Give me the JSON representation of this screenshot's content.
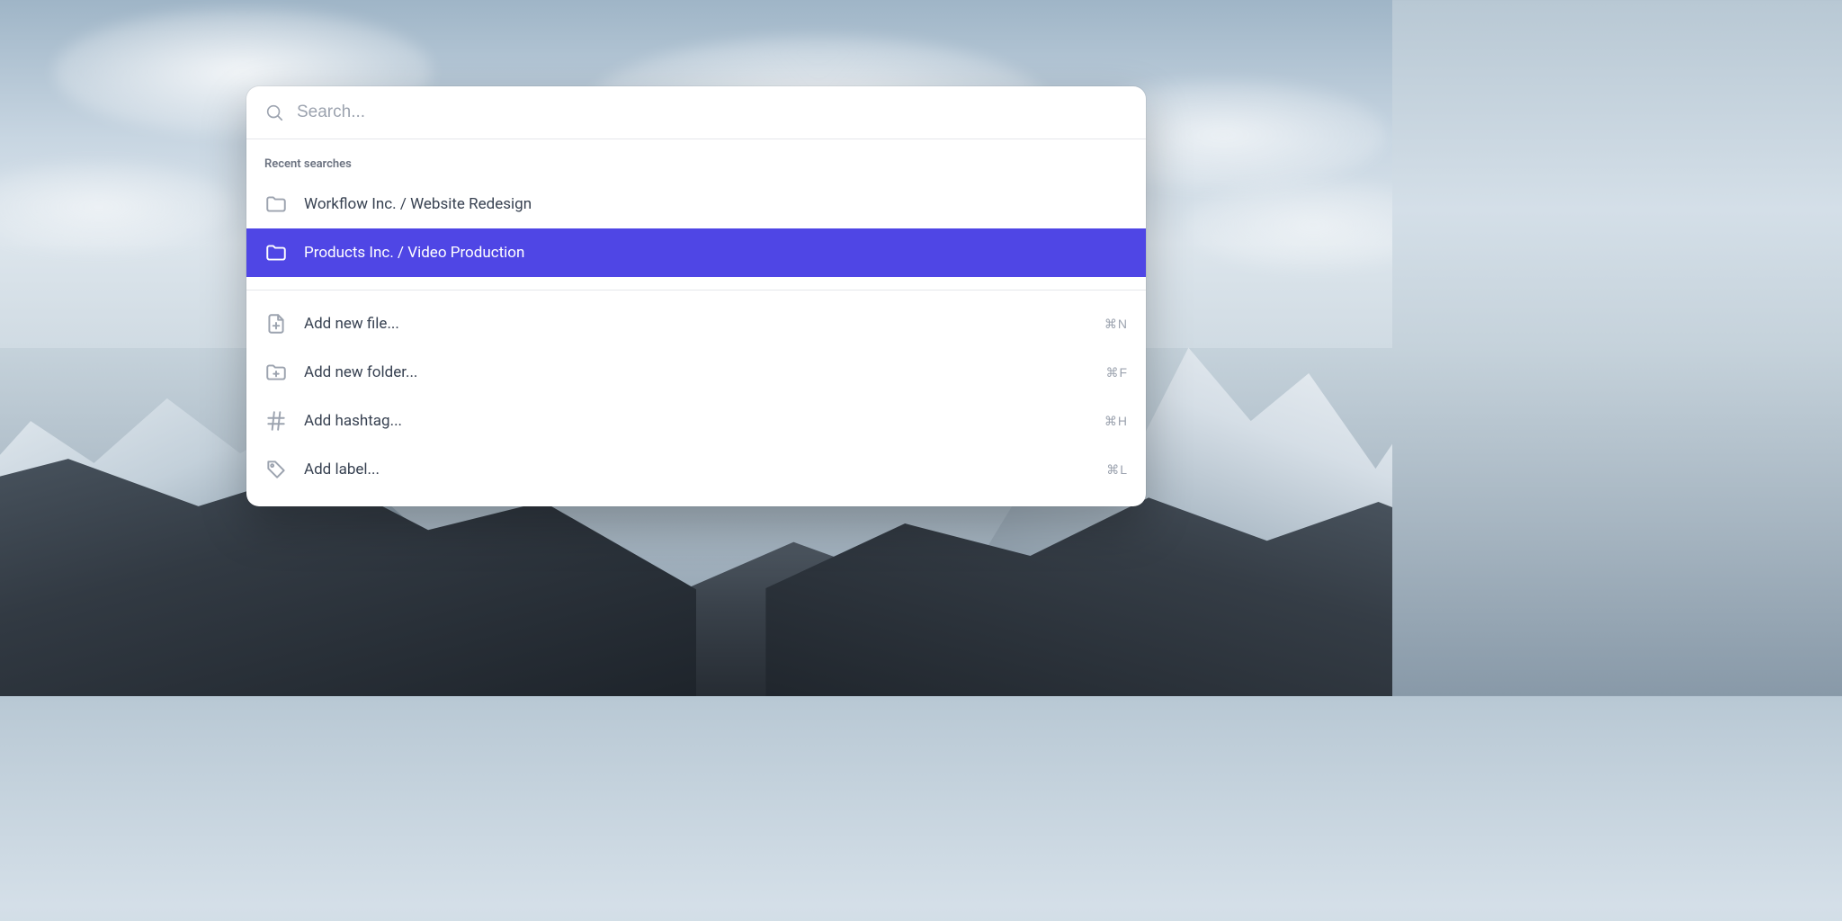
{
  "search": {
    "placeholder": "Search...",
    "value": ""
  },
  "recent": {
    "heading": "Recent searches",
    "items": [
      {
        "label": "Workflow Inc. / Website Redesign",
        "selected": false
      },
      {
        "label": "Products Inc. / Video Production",
        "selected": true
      }
    ]
  },
  "actions": {
    "items": [
      {
        "label": "Add new file...",
        "shortcut": "⌘N",
        "icon": "document-plus-icon"
      },
      {
        "label": "Add new folder...",
        "shortcut": "⌘F",
        "icon": "folder-plus-icon"
      },
      {
        "label": "Add hashtag...",
        "shortcut": "⌘H",
        "icon": "hashtag-icon"
      },
      {
        "label": "Add label...",
        "shortcut": "⌘L",
        "icon": "tag-icon"
      }
    ]
  },
  "colors": {
    "accent": "#4f46e5",
    "text": "#374151",
    "muted": "#9ca3af",
    "divider": "#e5e7eb",
    "panel": "#ffffff"
  }
}
